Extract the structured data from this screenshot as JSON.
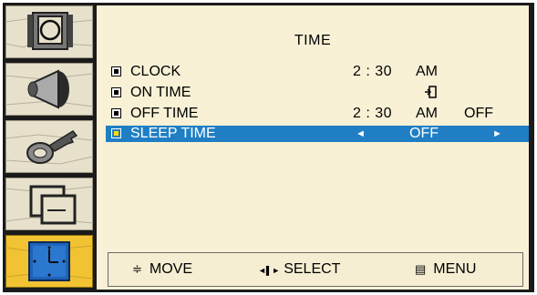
{
  "menu": {
    "title": "TIME",
    "rows": [
      {
        "label": "CLOCK",
        "time": "2 : 30",
        "ampm": "AM"
      },
      {
        "label": "ON TIME",
        "icon": "exit-icon"
      },
      {
        "label": "OFF TIME",
        "time": "2 : 30",
        "ampm": "AM",
        "state": "OFF"
      },
      {
        "label": "SLEEP TIME",
        "value": "OFF",
        "left_arrow": "◄",
        "right_arrow": "►"
      }
    ]
  },
  "footer": {
    "move_icon": "≑",
    "move": "MOVE",
    "select_icon": "◄▌►",
    "select": "SELECT",
    "menu_icon": "▤",
    "menu": "MENU"
  },
  "sidebar": {
    "tabs": [
      "picture-icon",
      "sound-icon",
      "key-icon",
      "screen-icon",
      "time-icon"
    ],
    "active": "time-icon"
  },
  "colors": {
    "panel": "#f8f1d6",
    "selected": "#1f7ec4",
    "active_tab": "#f1c232"
  }
}
